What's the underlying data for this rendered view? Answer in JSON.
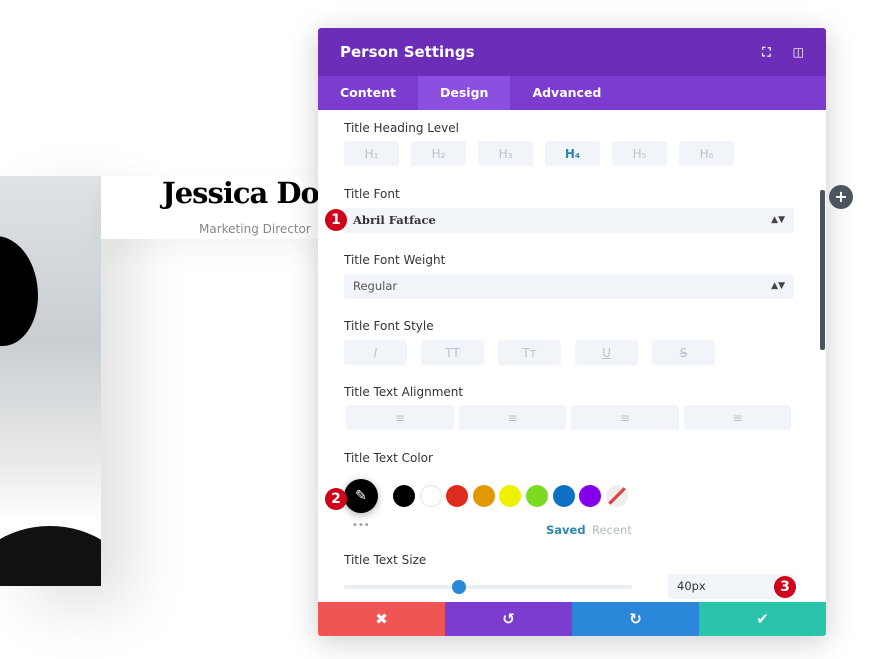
{
  "preview": {
    "name": "Jessica Do",
    "position": "Marketing Director"
  },
  "panel": {
    "title": "Person Settings",
    "tabs": [
      {
        "label": "Content"
      },
      {
        "label": "Design",
        "active": true
      },
      {
        "label": "Advanced"
      }
    ],
    "heading_level": {
      "label": "Title Heading Level",
      "options": [
        "H₁",
        "H₂",
        "H₃",
        "H₄",
        "H₅",
        "H₆"
      ],
      "selected": "H₄"
    },
    "font": {
      "label": "Title Font",
      "value": "Abril Fatface"
    },
    "weight": {
      "label": "Title Font Weight",
      "value": "Regular"
    },
    "style": {
      "label": "Title Font Style",
      "options": [
        "I",
        "TT",
        "Tт",
        "U",
        "S"
      ]
    },
    "alignment": {
      "label": "Title Text Alignment",
      "options": [
        "left",
        "center",
        "right",
        "justify"
      ]
    },
    "color": {
      "label": "Title Text Color",
      "swatches": [
        "#000000",
        "#ffffff",
        "#e02b20",
        "#e09900",
        "#edf000",
        "#7cda24",
        "#0c71c3",
        "#8300e9"
      ],
      "saved": "Saved",
      "recent": "Recent",
      "more": "•••"
    },
    "size": {
      "label": "Title Text Size",
      "value": "40px",
      "slider_percent": 40
    },
    "footer": {
      "cancel": "✖",
      "undo": "↺",
      "redo": "↻",
      "save": "✔"
    }
  },
  "badges": [
    "1",
    "2",
    "3"
  ],
  "colors": {
    "header": "#6c2eb9",
    "tabs": "#7b3ccf",
    "cancel": "#ef5555",
    "undo": "#7b3ccf",
    "redo": "#2b87da",
    "save": "#29c4a9"
  }
}
